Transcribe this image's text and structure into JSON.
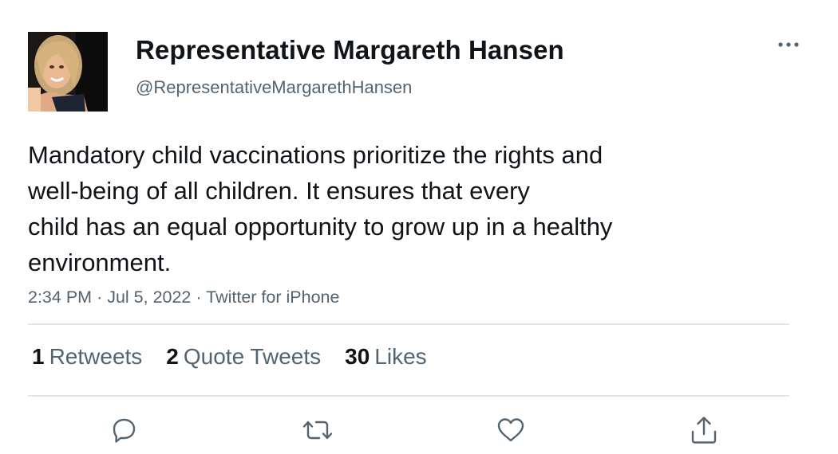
{
  "author": {
    "display_name": "Representative Margareth Hansen",
    "handle": "@RepresentativeMargarethHansen"
  },
  "tweet": {
    "text_lines": [
      "Mandatory child vaccinations prioritize the rights and",
      "well-being of all children. It ensures that every",
      "child has an equal opportunity to grow up in a healthy",
      "environment."
    ],
    "time": "2:34 PM",
    "date": "Jul 5, 2022",
    "separator": "·",
    "source": "Twitter for iPhone"
  },
  "stats": {
    "retweets": {
      "count": "1",
      "label": "Retweets"
    },
    "quote_tweets": {
      "count": "2",
      "label": "Quote Tweets"
    },
    "likes": {
      "count": "30",
      "label": "Likes"
    }
  },
  "icons": {
    "more": "more-horizontal-icon",
    "reply": "reply-icon",
    "retweet": "retweet-icon",
    "like": "heart-icon",
    "share": "share-icon"
  },
  "colors": {
    "text": "#0f1419",
    "secondary": "#536471",
    "icon": "#536471",
    "divider": "#e1e6ea"
  }
}
